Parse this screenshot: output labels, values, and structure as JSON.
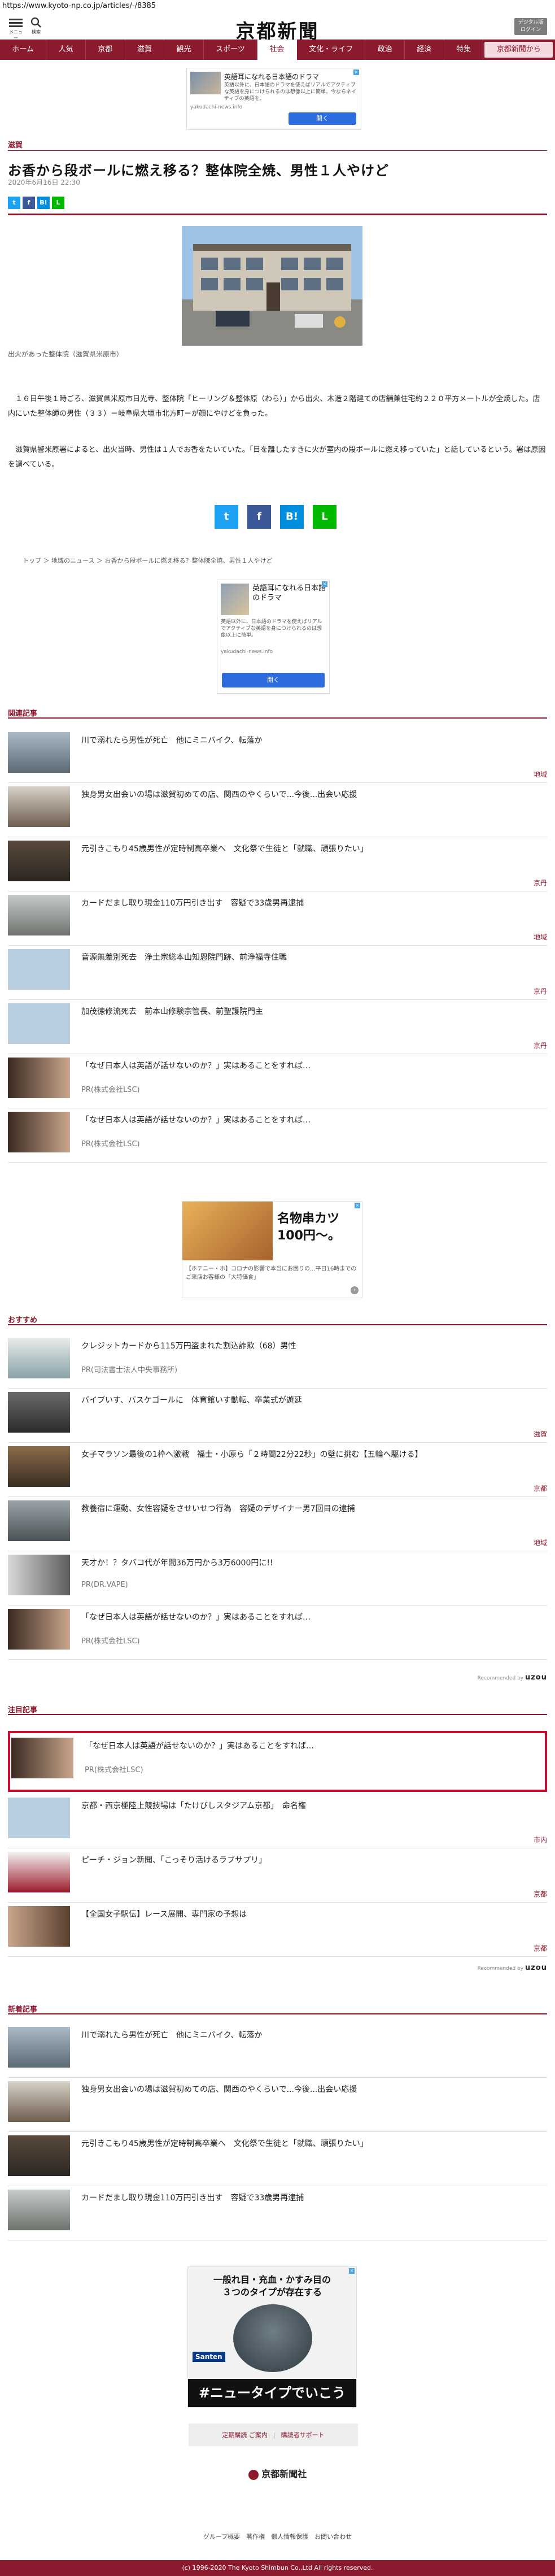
{
  "browser": {
    "url": "https://www.kyoto-np.co.jp/articles/-/8385"
  },
  "header": {
    "menu_label": "メニュー",
    "search_label": "検索",
    "logo": "京都新聞",
    "digital_label_1": "デジタル版",
    "digital_label_2": "ログイン"
  },
  "nav": [
    "ホーム",
    "人気",
    "京都",
    "滋賀",
    "観光",
    "スポーツ",
    "社会",
    "文化・ライフ",
    "政治",
    "経済",
    "特集",
    "京都新聞から"
  ],
  "ad_top": {
    "title": "英語耳になれる日本語のドラマ",
    "desc": "英語以外に、日本語のドラマを使えばリアルでアクティブな英語を身につけられるのは想像以上に簡単。今ならネイティブの英語を。",
    "source": "yakudachi-news.info",
    "button": "開く"
  },
  "article": {
    "category": "滋賀",
    "title": "お香から段ボールに燃え移る？整体院全焼、男性１人やけど",
    "date": "2020年6月16日 22:30",
    "caption": "出火があった整体院（滋賀県米原市）",
    "paragraph_1": "　１６日午後１時ごろ、滋賀県米原市日光寺、整体院「ヒーリング＆整体原（わら）」から出火、木造２階建ての店舗兼住宅約２２０平方メートルが全焼した。店内にいた整体師の男性（３３）＝岐阜県大垣市北方町＝が顔にやけどを負った。",
    "paragraph_2": "　滋賀県警米原署によると、出火当時、男性は１人でお香をたいていた。「目を離したすきに火が室内の段ボールに燃え移っていた」と話しているという。署は原因を調べている。"
  },
  "share": {
    "twitter": "t",
    "facebook": "f",
    "hatena": "B!",
    "line": "L"
  },
  "breadcrumb": [
    "トップ",
    "地域のニュース",
    "お香から段ボールに燃え移る？整体院全焼、男性１人やけど"
  ],
  "ad_mid": {
    "title": "英語耳になれる日本語のドラマ",
    "desc": "英語以外に、日本語のドラマを使えばリアルでアクティブな英語を身につけられるのは想像以上に簡単。",
    "source": "yakudachi-news.info",
    "button": "開く"
  },
  "related": {
    "title": "関連記事",
    "items": [
      {
        "title": "川で溺れたら男性が死亡　他にミニバイク、転落か",
        "tag": "地域"
      },
      {
        "title": "独身男女出会いの場は滋賀初めての店、関西のやくらいで...今後...出会い応援",
        "tag": ""
      },
      {
        "title": "元引きこもり45歳男性が定時制高卒業へ　文化祭で生徒と「就職、頑張りたい」",
        "tag": "京丹"
      },
      {
        "title": "カードだまし取り現金110万円引き出す　容疑で33歳男再逮捕",
        "tag": "地域"
      },
      {
        "title": "音源無差別死去　浄土宗総本山知恩院門跡、前浄福寺住職",
        "tag": "京丹"
      },
      {
        "title": "加茂徳修流死去　前本山修験宗管長、前聖護院門主",
        "tag": "京丹"
      },
      {
        "title": "「なぜ日本人は英語が話せないのか？」実はあることをすれば…",
        "sub": "PR(株式会社LSC)",
        "tag": ""
      },
      {
        "title": "「なぜ日本人は英語が話せないのか？」実はあることをすれば…",
        "sub": "PR(株式会社LSC)",
        "tag": ""
      }
    ]
  },
  "ad_food": {
    "title": "名物串カツ100円〜。",
    "desc": "【ホテニー・ホ】コロナの影響で本当にお困りの...平日16時までのご来店お客様の「大特価食」"
  },
  "recommended": {
    "title": "おすすめ",
    "items": [
      {
        "title": "クレジットカードから115万円盗まれた割込詐欺（68）男性",
        "sub": "PR(司法書士法人中央事務所)",
        "tag": ""
      },
      {
        "title": "バイブいす、バスケゴールに　体育館いす動転、卒業式が遊延",
        "tag": "滋賀"
      },
      {
        "title": "女子マラソン最後の1枠へ激戦　福士・小原ら「２時間22分22秒」の壁に挑む【五輪へ駆ける】",
        "tag": "京都"
      },
      {
        "title": "教養宿に運動、女性容疑をさせいせつ行為　容疑のデザイナー男7回目の逮捕",
        "tag": "地域"
      },
      {
        "title": "天才か！？タバコ代が年間36万円から3万6000円に!!",
        "sub": "PR(DR.VAPE)",
        "tag": ""
      },
      {
        "title": "「なぜ日本人は英語が話せないのか？」実はあることをすれば…",
        "sub": "PR(株式会社LSC)",
        "tag": ""
      }
    ],
    "powered": "Recommended by",
    "powered_brand": "uzou"
  },
  "featured": {
    "title": "注目記事",
    "items": [
      {
        "title": "「なぜ日本人は英語が話せないのか？」実はあることをすれば…",
        "sub": "PR(株式会社LSC)",
        "tag": ""
      },
      {
        "title": "京都・西京極陸上競技場は「たけびしスタジアム京都」　命名権",
        "tag": "市内"
      },
      {
        "title": "ピーチ・ジョン新聞、「こっそり活けるラブサプリ」",
        "tag": "京都"
      },
      {
        "title": "【全国女子駅伝】レース展開、専門家の予想は",
        "tag": "京都"
      }
    ],
    "powered": "Recommended by",
    "powered_brand": "uzou"
  },
  "latest": {
    "title": "新着記事",
    "items": [
      {
        "title": "川で溺れたら男性が死亡　他にミニバイク、転落か",
        "tag": ""
      },
      {
        "title": "独身男女出会いの場は滋賀初めての店、関西のやくらいで...今後...出会い応援",
        "tag": ""
      },
      {
        "title": "元引きこもり45歳男性が定時制高卒業へ　文化祭で生徒と「就職、頑張りたい」",
        "tag": ""
      },
      {
        "title": "カードだまし取り現金110万円引き出す　容疑で33歳男再逮捕",
        "tag": ""
      }
    ]
  },
  "ad_bottom": {
    "line_1": "一般れ目・充血・かすみ目の",
    "line_2": "３つのタイプが存在する",
    "brand": "Santen",
    "slogan": "#ニュータイプでいこう"
  },
  "footer": {
    "btn_1": "定期購読 ご案内",
    "btn_2": "購読者サポート",
    "logo": "京都新聞社",
    "links": "グループ概要　著作権　個人情報保護　お問い合わせ",
    "copyright": "(c) 1996-2020 The Kyoto Shimbun Co.,Ltd All rights reserved."
  },
  "colors": {
    "brand": "#8b1a2e",
    "highlight": "#c8102e",
    "ad_button": "#2d6cdf"
  }
}
